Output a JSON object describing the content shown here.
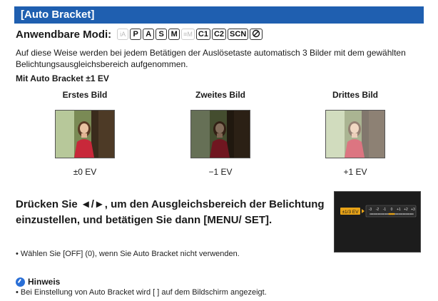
{
  "section_title": "[Auto Bracket]",
  "modes": {
    "label": "Anwendbare Modi:",
    "icons": [
      {
        "name": "intelligent-auto-icon",
        "text": "iA",
        "faint": true
      },
      {
        "name": "mode-p-icon",
        "text": "P",
        "faint": false
      },
      {
        "name": "mode-a-icon",
        "text": "A",
        "faint": false
      },
      {
        "name": "mode-s-icon",
        "text": "S",
        "faint": false
      },
      {
        "name": "mode-m-icon",
        "text": "M",
        "faint": false
      },
      {
        "name": "creative-video-icon",
        "text": "≡M",
        "faint": true
      },
      {
        "name": "mode-c1-icon",
        "text": "C1",
        "faint": false
      },
      {
        "name": "mode-c2-icon",
        "text": "C2",
        "faint": false
      },
      {
        "name": "mode-scn-icon",
        "text": "SCN",
        "faint": false
      },
      {
        "name": "creative-control-icon",
        "text": "",
        "faint": false
      }
    ]
  },
  "intro_text": "Auf diese Weise werden bei jedem Betätigen der Auslösetaste automatisch 3 Bilder mit dem gewählten Belichtungsausgleichsbereich aufgenommen.",
  "subheading": "Mit Auto Bracket ±1 EV",
  "columns": [
    {
      "title": "Erstes Bild",
      "value": "±0 EV",
      "exposure": 1.0
    },
    {
      "title": "Zweites Bild",
      "value": "−1 EV",
      "exposure": 0.6
    },
    {
      "title": "Drittes Bild",
      "value": "+1 EV",
      "exposure": 1.4
    }
  ],
  "instruction": "Drücken Sie ◄/►, um den Ausgleichsbereich der Belichtung einzustellen, und betätigen Sie dann [MENU/ SET].",
  "note": "• Wählen Sie [OFF] (0), wenn Sie Auto Bracket nicht verwenden.",
  "screen": {
    "badge": "±1/3 EV",
    "scale": [
      "-3",
      "-2",
      "-1",
      "0",
      "+1",
      "+2",
      "+3"
    ]
  },
  "hint": {
    "label": "Hinweis",
    "text": "• Bei Einstellung von Auto Bracket wird [ ] auf dem Bildschirm angezeigt."
  },
  "colors": {
    "title_bar": "#1f5fb0",
    "accent_orange": "#e8a317",
    "hint_icon": "#2a6fd6"
  }
}
